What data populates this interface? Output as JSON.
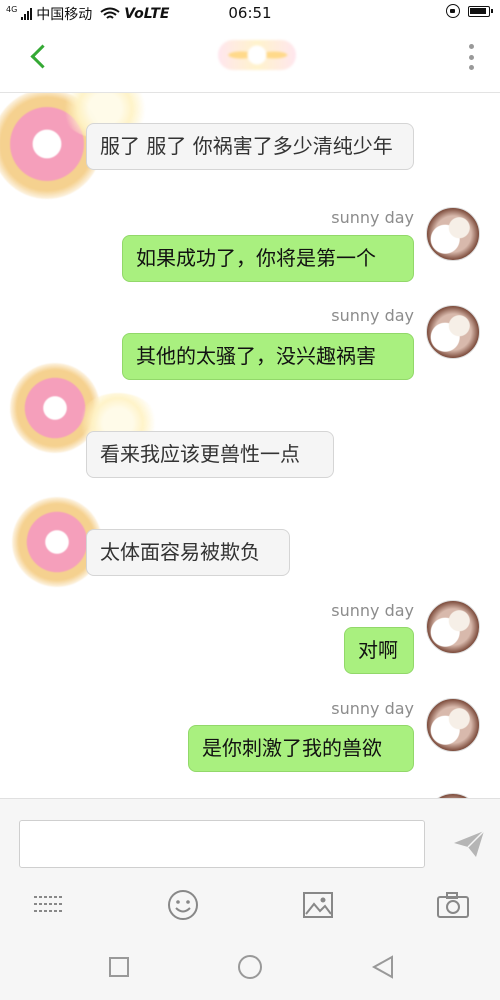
{
  "status_bar": {
    "network_type": "4G",
    "carrier": "中国移动",
    "volte": "VoLTE",
    "time": "06:51"
  },
  "header": {
    "back_icon": "chevron-left-icon",
    "more_icon": "vertical-dots-icon",
    "accent_color": "#35a935"
  },
  "messages": [
    {
      "direction": "in",
      "sender": "",
      "text": "服了 服了 你祸害了多少清纯少年"
    },
    {
      "direction": "out",
      "sender": "sunny day",
      "text": "如果成功了，你将是第一个"
    },
    {
      "direction": "out",
      "sender": "sunny day",
      "text": "其他的太骚了，没兴趣祸害"
    },
    {
      "direction": "in",
      "sender": "",
      "text": "看来我应该更兽性一点"
    },
    {
      "direction": "in",
      "sender": "",
      "text": "太体面容易被欺负"
    },
    {
      "direction": "out",
      "sender": "sunny day",
      "text": "对啊"
    },
    {
      "direction": "out",
      "sender": "sunny day",
      "text": "是你刺激了我的兽欲"
    }
  ],
  "composer": {
    "input_value": "",
    "send_icon": "paper-plane-icon",
    "tools": [
      "keyboard-icon",
      "emoji-icon",
      "image-icon",
      "camera-icon"
    ]
  },
  "colors": {
    "outgoing_bubble": "#a9f07f",
    "incoming_bubble": "#f5f5f5"
  }
}
